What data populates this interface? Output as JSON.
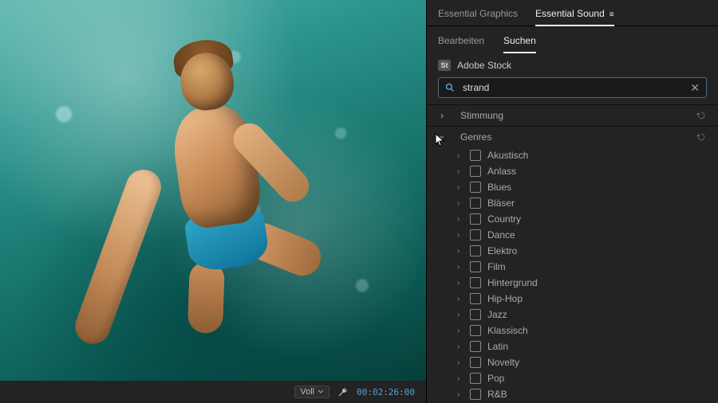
{
  "panel_tabs": {
    "graphics": "Essential Graphics",
    "sound": "Essential Sound"
  },
  "subtabs": {
    "edit": "Bearbeiten",
    "search": "Suchen"
  },
  "stock": {
    "badge": "St",
    "label": "Adobe Stock"
  },
  "search": {
    "value": "strand"
  },
  "categories": {
    "mood": "Stimmung",
    "genres": "Genres"
  },
  "genres": [
    "Akustisch",
    "Anlass",
    "Blues",
    "Bläser",
    "Country",
    "Dance",
    "Elektro",
    "Film",
    "Hintergrund",
    "Hip-Hop",
    "Jazz",
    "Klassisch",
    "Latin",
    "Novelty",
    "Pop",
    "R&B"
  ],
  "monitor": {
    "zoom": "Voll",
    "timecode": "00:02:26:00"
  }
}
